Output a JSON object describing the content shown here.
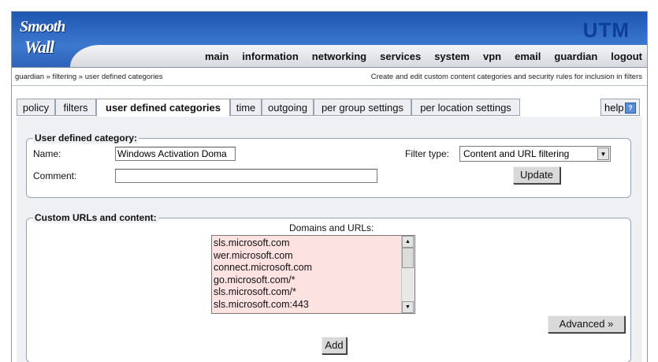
{
  "header": {
    "logo_line1": "Smooth",
    "logo_line2": "Wall",
    "product": "UTM",
    "nav": [
      "main",
      "information",
      "networking",
      "services",
      "system",
      "vpn",
      "email",
      "guardian",
      "logout"
    ]
  },
  "breadcrumb": {
    "path": "guardian » filtering » user defined categories",
    "description": "Create and edit custom content categories and security rules for inclusion in filters"
  },
  "tabs": [
    "policy",
    "filters",
    "user defined categories",
    "time",
    "outgoing",
    "per group settings",
    "per location settings"
  ],
  "active_tab": "user defined categories",
  "help_label": "help",
  "help_icon": "question-icon",
  "category": {
    "legend": "User defined category:",
    "name_label": "Name:",
    "name_value": "Windows Activation Doma",
    "comment_label": "Comment:",
    "comment_value": "",
    "filter_type_label": "Filter type:",
    "filter_type_value": "Content and URL filtering",
    "update_label": "Update"
  },
  "custom": {
    "legend": "Custom URLs and content:",
    "domains_label": "Domains and URLs:",
    "domains": [
      "sls.microsoft.com",
      "wer.microsoft.com",
      "connect.microsoft.com",
      "go.microsoft.com/*",
      "sls.microsoft.com/*",
      "sls.microsoft.com:443"
    ],
    "advanced_label": "Advanced »",
    "add_label": "Add"
  }
}
